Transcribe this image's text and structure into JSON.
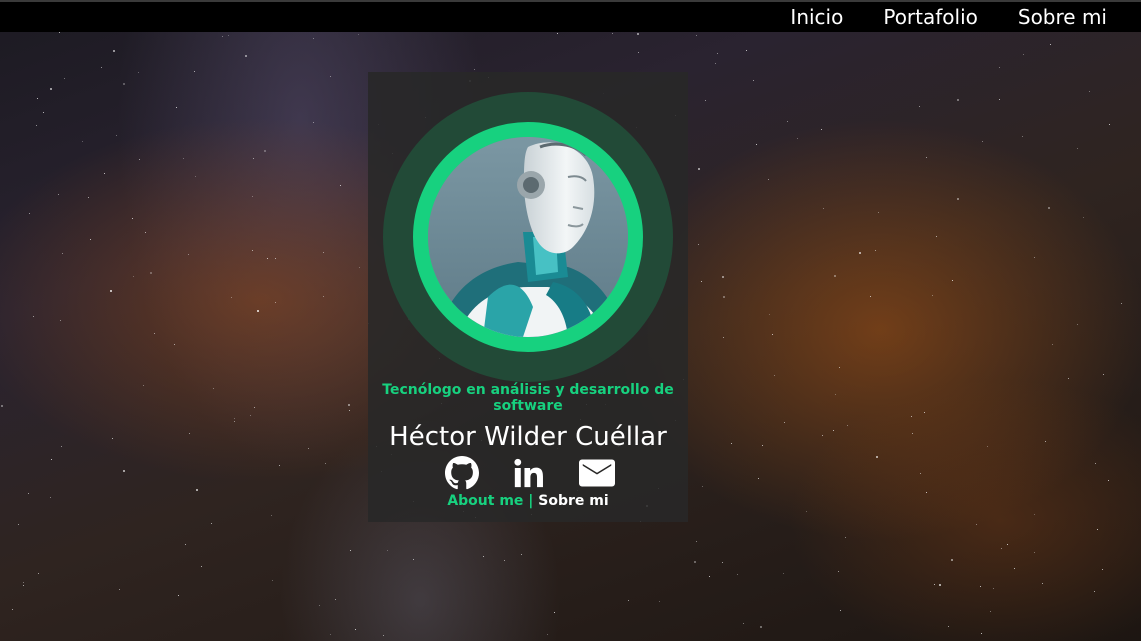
{
  "nav": {
    "items": [
      {
        "label": "Inicio"
      },
      {
        "label": "Portafolio"
      },
      {
        "label": "Sobre mi"
      }
    ]
  },
  "profile": {
    "subtitle": "Tecnólogo en análisis y desarrollo de software",
    "name": "Héctor Wilder Cuéllar",
    "socials": [
      {
        "icon": "github-icon"
      },
      {
        "icon": "linkedin-icon"
      },
      {
        "icon": "mail-icon"
      }
    ],
    "about_en": "About me",
    "separator": "|",
    "about_es": "Sobre mi"
  },
  "colors": {
    "accent": "#17d17f",
    "ring_dark": "#224a37",
    "card_bg": "#282828",
    "nav_bg": "#000000"
  }
}
